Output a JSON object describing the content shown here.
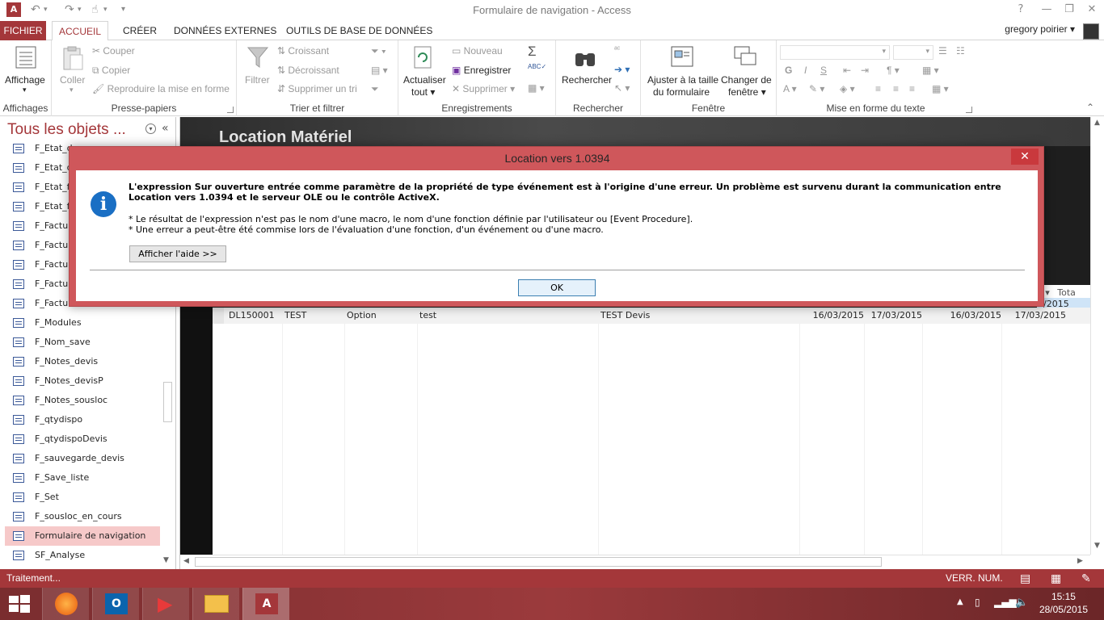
{
  "window": {
    "title": "Formulaire de navigation - Access",
    "help": "?",
    "minimize": "—",
    "restore": "❐",
    "close": "✕"
  },
  "qat": {
    "undo": "↶",
    "redo": "↷",
    "more": "▾"
  },
  "ribbon_tabs": [
    {
      "label": "FICHIER"
    },
    {
      "label": "ACCUEIL"
    },
    {
      "label": "CRÉER"
    },
    {
      "label": "DONNÉES EXTERNES"
    },
    {
      "label": "OUTILS DE BASE DE DONNÉES"
    }
  ],
  "user": {
    "name": "gregory poirier"
  },
  "ribbon": {
    "affichages": {
      "button": "Affichage",
      "label": "Affichages"
    },
    "presse_papiers": {
      "coller": "Coller",
      "couper": "Couper",
      "copier": "Copier",
      "reproduire": "Reproduire la mise en forme",
      "label": "Presse-papiers"
    },
    "trier": {
      "filtrer": "Filtrer",
      "croissant": "Croissant",
      "decroissant": "Décroissant",
      "supprimer_tri": "Supprimer un tri",
      "label": "Trier et filtrer"
    },
    "enregistrements": {
      "actualiser_1": "Actualiser",
      "actualiser_2": "tout",
      "nouveau": "Nouveau",
      "enregistrer": "Enregistrer",
      "supprimer": "Supprimer",
      "label": "Enregistrements"
    },
    "rechercher": {
      "button": "Rechercher",
      "label": "Rechercher"
    },
    "fenetre": {
      "ajuster_1": "Ajuster à la taille",
      "ajuster_2": "du formulaire",
      "changer_1": "Changer de",
      "changer_2": "fenêtre",
      "label": "Fenêtre"
    },
    "mise_en_forme": {
      "bold": "G",
      "italic": "I",
      "underline": "S",
      "font_a": "A",
      "label": "Mise en forme du texte"
    }
  },
  "nav": {
    "title": "Tous les objets ...",
    "items": [
      {
        "label": "F_Etat_d"
      },
      {
        "label": "F_Etat_d"
      },
      {
        "label": "F_Etat_fa"
      },
      {
        "label": "F_Etat_fa"
      },
      {
        "label": "F_Factur"
      },
      {
        "label": "F_Factur"
      },
      {
        "label": "F_Factur"
      },
      {
        "label": "F_Factur"
      },
      {
        "label": "F_Factur"
      },
      {
        "label": "F_Modules"
      },
      {
        "label": "F_Nom_save"
      },
      {
        "label": "F_Notes_devis"
      },
      {
        "label": "F_Notes_devisP"
      },
      {
        "label": "F_Notes_sousloc"
      },
      {
        "label": "F_qtydispo"
      },
      {
        "label": "F_qtydispoDevis"
      },
      {
        "label": "F_sauvegarde_devis"
      },
      {
        "label": "F_Save_liste"
      },
      {
        "label": "F_Set"
      },
      {
        "label": "F_sousloc_en_cours"
      },
      {
        "label": "Formulaire de navigation"
      },
      {
        "label": "SF_Analyse"
      }
    ],
    "selected_index": 20
  },
  "form": {
    "title": "Location Matériel",
    "header_partial": [
      "o",
      "Tota"
    ],
    "highlight_cell": "/2015",
    "row": {
      "ref": "DL150001",
      "client": "TEST",
      "statut": "Option",
      "nom": "test",
      "objet": "TEST Devis",
      "d1": "16/03/2015",
      "d2": "17/03/2015",
      "d3": "16/03/2015",
      "d4": "17/03/2015"
    }
  },
  "status": {
    "left": "Traitement...",
    "right": "VERR. NUM."
  },
  "taskbar": {
    "time": "15:15",
    "date": "28/05/2015"
  },
  "dialog": {
    "title": "Location vers 1.0394",
    "close": "✕",
    "message": "L'expression Sur ouverture entrée comme paramètre de la propriété de type événement est à l'origine d'une erreur. Un problème est survenu durant la communication entre Location vers 1.0394 et le serveur OLE ou le contrôle ActiveX.",
    "bullet1": "* Le résultat de l'expression n'est pas le nom d'une macro, le nom d'une fonction définie par l'utilisateur ou [Event Procedure].",
    "bullet2": "* Une erreur a peut-être été commise lors de l'évaluation d'une fonction, d'un événement ou d'une macro.",
    "help_button": "Afficher l'aide >>",
    "ok_button": "OK"
  },
  "colors": {
    "accent": "#a4373a",
    "dialog_frame": "#cf575b",
    "selected_nav": "#f6c9c9",
    "info_blue": "#1a6fc4"
  }
}
